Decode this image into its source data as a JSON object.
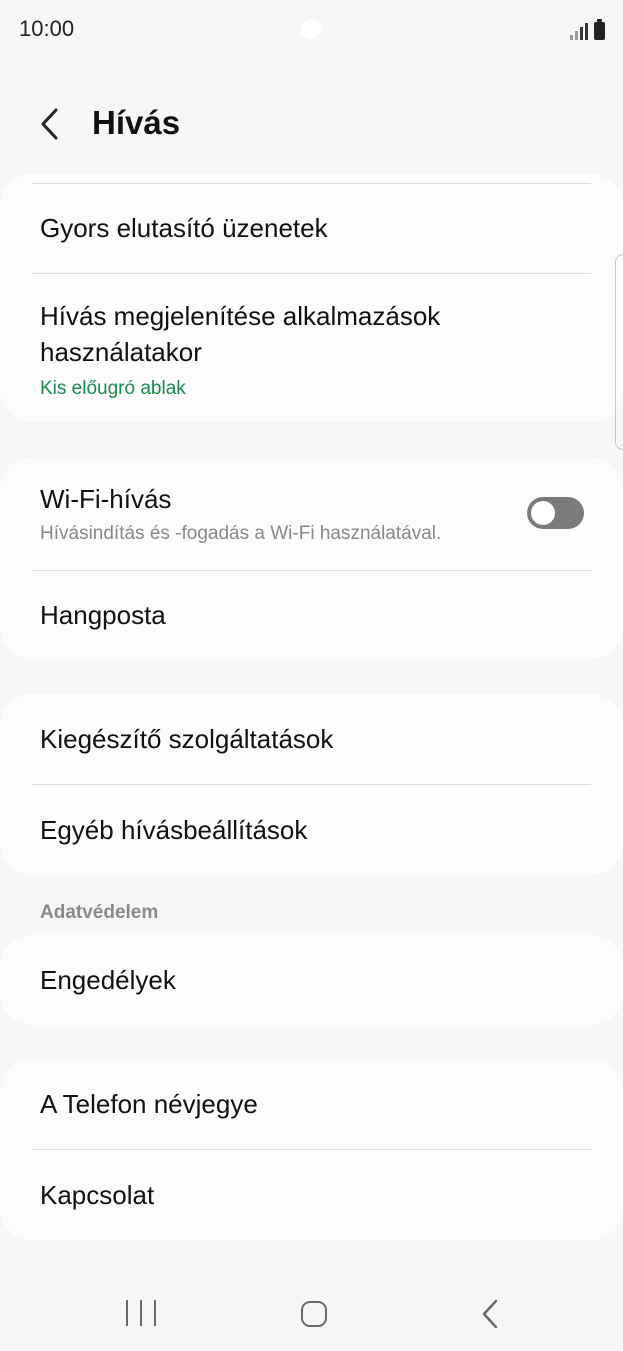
{
  "status_bar": {
    "time": "10:00"
  },
  "header": {
    "title": "Hívás"
  },
  "group1": {
    "quick_decline": "Gyors elutasító üzenetek",
    "call_display_title_line1": "Hívás megjelenítése alkalmazások",
    "call_display_title_line2": "használatakor",
    "call_display_value": "Kis előugró ablak",
    "accent_color": "#1a8a4a"
  },
  "group2": {
    "wifi_calling_title": "Wi-Fi-hívás",
    "wifi_calling_sub": "Hívásindítás és -fogadás a Wi-Fi használatával.",
    "wifi_calling_enabled": false,
    "voicemail": "Hangposta"
  },
  "group3": {
    "supplementary": "Kiegészítő szolgáltatások",
    "other_settings": "Egyéb hívásbeállítások"
  },
  "privacy": {
    "section_label": "Adatvédelem",
    "permissions": "Engedélyek"
  },
  "group5": {
    "about": "A Telefon névjegye",
    "contact": "Kapcsolat"
  },
  "navbar": {
    "icons": [
      "recents-icon",
      "home-icon",
      "back-icon"
    ]
  }
}
